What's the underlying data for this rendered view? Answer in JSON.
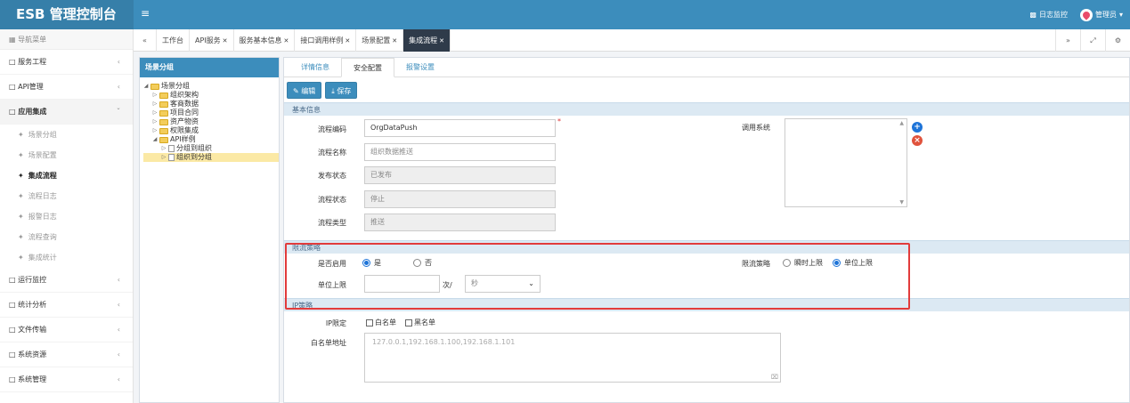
{
  "header": {
    "title": "ESB 管理控制台",
    "menu_icon": "hamburger-icon",
    "log_monitor": "日志监控",
    "user": "管理员"
  },
  "sidebar": {
    "title": "导航菜单",
    "groups": [
      {
        "label": "服务工程"
      },
      {
        "label": "API管理"
      },
      {
        "label": "应用集成"
      }
    ],
    "sub_items": [
      {
        "label": "场景分组"
      },
      {
        "label": "场景配置"
      },
      {
        "label": "集成流程"
      },
      {
        "label": "流程日志"
      },
      {
        "label": "报警日志"
      },
      {
        "label": "流程查询"
      },
      {
        "label": "集成统计"
      }
    ],
    "groups_after": [
      {
        "label": "运行监控"
      },
      {
        "label": "统计分析"
      },
      {
        "label": "文件传输"
      },
      {
        "label": "系统资源"
      },
      {
        "label": "系统管理"
      }
    ]
  },
  "tabs": [
    {
      "label": "工作台"
    },
    {
      "label": "API服务"
    },
    {
      "label": "服务基本信息"
    },
    {
      "label": "接口调用样例"
    },
    {
      "label": "场景配置"
    },
    {
      "label": "集成流程"
    }
  ],
  "tree_panel": {
    "title": "场景分组",
    "nodes": [
      {
        "label": "场景分组"
      },
      {
        "label": "组织架构"
      },
      {
        "label": "客商数据"
      },
      {
        "label": "项目合同"
      },
      {
        "label": "资产物资"
      },
      {
        "label": "权限集成"
      },
      {
        "label": "API样例"
      },
      {
        "label": "分组到组织"
      },
      {
        "label": "组织到分组"
      }
    ]
  },
  "main": {
    "subtabs": [
      "详情信息",
      "安全配置",
      "报警设置"
    ],
    "buttons": {
      "edit": "编辑",
      "save": "保存"
    },
    "section_basic": "基本信息",
    "fields": {
      "code_label": "流程编码",
      "code_value": "OrgDataPush",
      "name_label": "流程名称",
      "name_value": "组织数据推送",
      "publish_label": "发布状态",
      "publish_value": "已发布",
      "state_label": "流程状态",
      "state_value": "停止",
      "type_label": "流程类型",
      "type_value": "推送",
      "system_label": "调用系统"
    },
    "section_limit": "限流策略",
    "limit": {
      "enable_label": "是否启用",
      "yes": "是",
      "no": "否",
      "policy_label": "限流策略",
      "instant": "瞬时上限",
      "unit": "单位上限",
      "unit_label": "单位上限",
      "times": "次/",
      "period": "秒"
    },
    "section_ip": "IP策略",
    "ip": {
      "limit_label": "IP限定",
      "whitelist": "白名单",
      "blacklist": "黑名单",
      "addr_label": "白名单地址",
      "addr_value": "127.0.0.1,192.168.1.100,192.168.1.101"
    }
  },
  "colors": {
    "primary": "#3c8dbc",
    "highlight": "#e23b3b",
    "active_tab": "#2f3b4a"
  }
}
